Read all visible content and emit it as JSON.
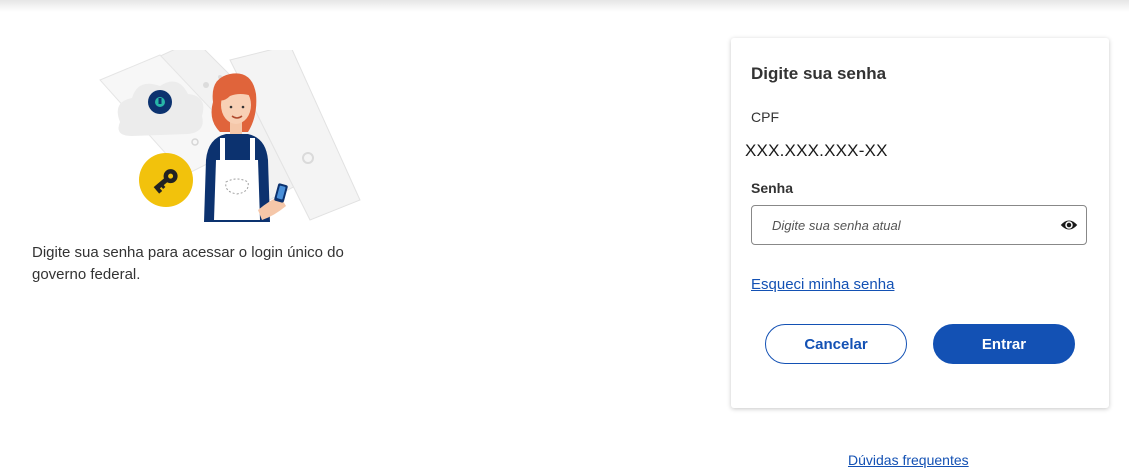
{
  "intro": {
    "text": "Digite sua senha para acessar o login único do governo federal."
  },
  "card": {
    "title": "Digite sua senha",
    "cpf_label": "CPF",
    "cpf_value": "XXX.XXX.XXX-XX",
    "password_label": "Senha",
    "password_placeholder": "Digite sua senha atual",
    "password_value": "",
    "forgot_link": "Esqueci minha senha",
    "cancel_button": "Cancelar",
    "enter_button": "Entrar"
  },
  "footer": {
    "faq_link": "Dúvidas frequentes"
  },
  "icons": {
    "show_password": "eye-icon",
    "illustration": "woman-with-phone-and-key-illustration"
  },
  "colors": {
    "primary": "#1351b4",
    "key_badge": "#f2c20c",
    "lock_badge": "#0c326f",
    "hair": "#e0643b",
    "apron": "#0c326f"
  }
}
